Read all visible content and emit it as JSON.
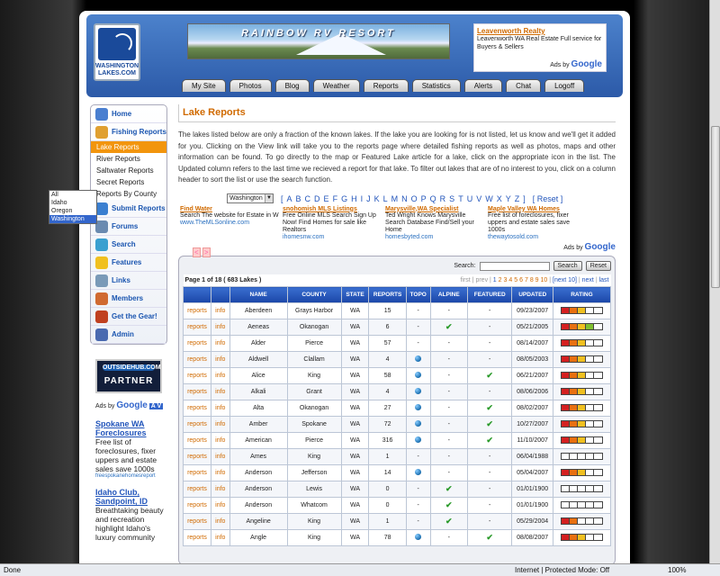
{
  "header": {
    "logo_line1": "WASHINGTON",
    "logo_line2": "LAKES.COM",
    "banner_text": "RAINBOW RV RESORT",
    "ad": {
      "title": "Leavenworth Realty",
      "text": "Leavenworth WA Real Estate Full service for Buyers & Sellers",
      "ads_by": "Ads by",
      "google": "Google"
    }
  },
  "nav": [
    "My Site",
    "Photos",
    "Blog",
    "Weather",
    "Reports",
    "Statistics",
    "Alerts",
    "Chat",
    "Logoff"
  ],
  "sidebar": {
    "items": [
      {
        "label": "Home",
        "icon": "home-icon",
        "color": "#4a7fd0"
      },
      {
        "label": "Fishing Reports",
        "icon": "fishing-reports-icon",
        "color": "#e0a030"
      }
    ],
    "subitems": [
      "Lake Reports",
      "River Reports",
      "Saltwater Reports",
      "Secret Reports",
      "Reports By County"
    ],
    "items2": [
      {
        "label": "Submit Reports",
        "icon": "submit-icon",
        "color": "#3a7fd0"
      },
      {
        "label": "Forums",
        "icon": "forums-icon",
        "color": "#6a8ab0"
      },
      {
        "label": "Search",
        "icon": "search-icon",
        "color": "#3aa0d0"
      },
      {
        "label": "Features",
        "icon": "star-icon",
        "color": "#f0c020"
      },
      {
        "label": "Links",
        "icon": "links-icon",
        "color": "#7a9ab8"
      },
      {
        "label": "Members",
        "icon": "members-icon",
        "color": "#d06a30"
      },
      {
        "label": "Get the Gear!",
        "icon": "gear-icon",
        "color": "#c04020"
      },
      {
        "label": "Admin",
        "icon": "admin-icon",
        "color": "#4a6ab0"
      }
    ],
    "partner_top": "OUTSIDEHUB.COM",
    "partner_bottom": "PARTNER",
    "ads_by": "Ads by",
    "google": "Google",
    "av": "A V",
    "ads": [
      {
        "title": "Spokane WA Foreclosures",
        "text": "Free list of foreclosures, fixer uppers and estate sales save 1000s",
        "url": "freespokanehomesreport"
      },
      {
        "title": "Idaho Club, Sandpoint, ID",
        "text": "Breathtaking beauty and recreation highlight Idaho's luxury community",
        "url": ""
      }
    ]
  },
  "main": {
    "title": "Lake Reports",
    "intro": "The lakes listed below are only a fraction of the known lakes. If the lake you are looking for is not listed, let us know and we'll get it added for you. Clicking on the View link will take you to the reports page where detailed fishing reports as well as photos, maps and other information can be found. To go directly to the map or Featured Lake article for a lake, click on the appropriate icon in the list. The Updated column refers to the last time we recieved a report for that lake. To filter out lakes that are of no interest to you, click on a column header to sort the list or use the search function.",
    "state_select": "Washington",
    "state_options": [
      "All",
      "Idaho",
      "Oregon",
      "Washington"
    ],
    "letters": [
      "[",
      "A",
      "B",
      "C",
      "D",
      "E",
      "F",
      "G",
      "H",
      "I",
      "J",
      "K",
      "L",
      "M",
      "N",
      "O",
      "P",
      "Q",
      "R",
      "S",
      "T",
      "U",
      "V",
      "W",
      "X",
      "Y",
      "Z",
      "]"
    ],
    "reset": "[ Reset ]",
    "ads": [
      {
        "title": "Find Water",
        "text": "Search The website for Estate in W",
        "url": "www.TheMLSonline.com"
      },
      {
        "title": "snohomish MLS Listings",
        "text": "Free Online MLS Search Sign Up Now! Find Homes for sale like Realtors",
        "url": "ihomesnw.com"
      },
      {
        "title": "Marysville,WA Specialist",
        "text": "Ted Wright Knows Marysville Search Database Find/Sell your Home",
        "url": "homesbyted.com"
      },
      {
        "title": "Maple Valley WA Homes",
        "text": "Free list of foreclosures, fixer uppers and estate sales save 1000s",
        "url": "thewaytosold.com"
      }
    ],
    "ads_by": "Ads by",
    "google": "Google",
    "search_label": "Search:",
    "search_value": "",
    "search_button": "Search",
    "reset_button": "Reset",
    "page_info": "Page 1 of 18 ( 683 Lakes )",
    "pager": {
      "first": "first",
      "prev": "prev",
      "pages": [
        "1",
        "2",
        "3",
        "4",
        "5",
        "6",
        "7",
        "8",
        "9",
        "10"
      ],
      "next10": "next 10",
      "next": "next",
      "last": "last"
    },
    "columns": [
      "",
      "",
      "NAME",
      "COUNTY",
      "STATE",
      "REPORTS",
      "TOPO",
      "ALPINE",
      "FEATURED",
      "UPDATED",
      "RATING"
    ],
    "rows": [
      {
        "name": "Aberdeen",
        "county": "Grays Harbor",
        "state": "WA",
        "reports": "15",
        "topo": "-",
        "alpine": "-",
        "featured": "-",
        "updated": "09/23/2007",
        "rating": 3
      },
      {
        "name": "Aeneas",
        "county": "Okanogan",
        "state": "WA",
        "reports": "6",
        "topo": "-",
        "alpine": "check",
        "featured": "-",
        "updated": "05/21/2005",
        "rating": 4
      },
      {
        "name": "Alder",
        "county": "Pierce",
        "state": "WA",
        "reports": "57",
        "topo": "-",
        "alpine": "-",
        "featured": "-",
        "updated": "08/14/2007",
        "rating": 3
      },
      {
        "name": "Aldwell",
        "county": "Clallam",
        "state": "WA",
        "reports": "4",
        "topo": "globe",
        "alpine": "-",
        "featured": "-",
        "updated": "08/05/2003",
        "rating": 3
      },
      {
        "name": "Alice",
        "county": "King",
        "state": "WA",
        "reports": "58",
        "topo": "globe",
        "alpine": "-",
        "featured": "check",
        "updated": "06/21/2007",
        "rating": 3
      },
      {
        "name": "Alkali",
        "county": "Grant",
        "state": "WA",
        "reports": "4",
        "topo": "globe",
        "alpine": "-",
        "featured": "-",
        "updated": "08/06/2006",
        "rating": 3
      },
      {
        "name": "Alta",
        "county": "Okanogan",
        "state": "WA",
        "reports": "27",
        "topo": "globe",
        "alpine": "-",
        "featured": "check",
        "updated": "08/02/2007",
        "rating": 3
      },
      {
        "name": "Amber",
        "county": "Spokane",
        "state": "WA",
        "reports": "72",
        "topo": "globe",
        "alpine": "-",
        "featured": "check",
        "updated": "10/27/2007",
        "rating": 3
      },
      {
        "name": "American",
        "county": "Pierce",
        "state": "WA",
        "reports": "316",
        "topo": "globe",
        "alpine": "-",
        "featured": "check",
        "updated": "11/10/2007",
        "rating": 3
      },
      {
        "name": "Ames",
        "county": "King",
        "state": "WA",
        "reports": "1",
        "topo": "-",
        "alpine": "-",
        "featured": "-",
        "updated": "06/04/1988",
        "rating": 0
      },
      {
        "name": "Anderson",
        "county": "Jefferson",
        "state": "WA",
        "reports": "14",
        "topo": "globe",
        "alpine": "-",
        "featured": "-",
        "updated": "05/04/2007",
        "rating": 3
      },
      {
        "name": "Anderson",
        "county": "Lewis",
        "state": "WA",
        "reports": "0",
        "topo": "-",
        "alpine": "check",
        "featured": "-",
        "updated": "01/01/1900",
        "rating": 0
      },
      {
        "name": "Anderson",
        "county": "Whatcom",
        "state": "WA",
        "reports": "0",
        "topo": "-",
        "alpine": "check",
        "featured": "-",
        "updated": "01/01/1900",
        "rating": 0
      },
      {
        "name": "Angeline",
        "county": "King",
        "state": "WA",
        "reports": "1",
        "topo": "-",
        "alpine": "check",
        "featured": "-",
        "updated": "05/29/2004",
        "rating": 2
      },
      {
        "name": "Angle",
        "county": "King",
        "state": "WA",
        "reports": "78",
        "topo": "globe",
        "alpine": "-",
        "featured": "check",
        "updated": "08/08/2007",
        "rating": 3
      }
    ],
    "row_links": {
      "reports": "reports",
      "info": "info"
    },
    "rating_colors": [
      "#d42020",
      "#e87010",
      "#f0c020",
      "#80c030",
      "#ffffff"
    ]
  },
  "statusbar": {
    "left": "Done",
    "zone": "Internet | Protected Mode: Off",
    "zoom": "100%"
  }
}
